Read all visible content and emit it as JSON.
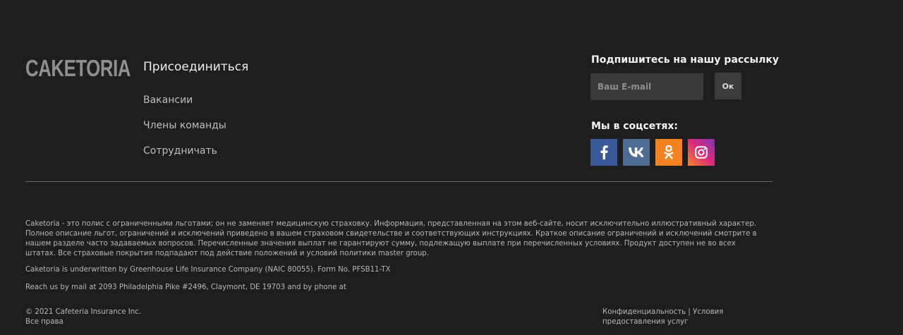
{
  "brand": {
    "logo_text": "CAKETORIA"
  },
  "links": {
    "heading": "Присоединиться",
    "items": [
      {
        "label": "Вакансии"
      },
      {
        "label": "Члены команды"
      },
      {
        "label": "Сотрудничать"
      }
    ]
  },
  "newsletter": {
    "heading": "Подпишитесь на нашу рассылку",
    "email_placeholder": "Ваш E-mail",
    "email_value": "",
    "submit_label": "Ок"
  },
  "social": {
    "heading": "Мы в соцсетях:",
    "networks": [
      {
        "name": "facebook",
        "icon": "facebook-icon",
        "color": "#3b5998"
      },
      {
        "name": "vk",
        "icon": "vk-icon",
        "color": "#4c6c91"
      },
      {
        "name": "odnoklassniki",
        "icon": "odnoklassniki-icon",
        "color": "#f58220"
      },
      {
        "name": "instagram",
        "icon": "instagram-icon",
        "color": "#dd2a7b"
      }
    ]
  },
  "legal": {
    "disclaimer": "Caketoria - это полис с ограниченными льготами; он не заменяет медицинскую страховку. Информация, представленная на этом веб-сайте, носит исключительно иллюстративный характер. Полное описание льгот, ограничений и исключений приведено в вашем страховом свидетельстве и соответствующих инструкциях. Краткое описание ограничений и исключений смотрите в нашем разделе часто задаваемых вопросов. Перечисленные значения выплат не гарантируют сумму, подлежащую выплате при перечисленных условиях. Продукт доступен не во всех штатах. Все страховые покрытия подпадают под действие положений и условий политики master group.",
    "underwriter": "Caketoria is underwritten by Greenhouse Life Insurance Company (NAIC 80055). Form No. PFSB11-TX",
    "contact": "Reach us by mail at 2093 Philadelphia Pike #2496, Claymont, DE 19703 and by phone at",
    "copyright_line1": "© 2021 Cafeteria Insurance Inc.",
    "copyright_line2": "Все права",
    "privacy_label": "Конфиденциальность",
    "separator": " | ",
    "terms_label": "Условия предоставления услуг"
  },
  "colors": {
    "background": "#1f1e1f",
    "divider": "#6a6a6a"
  }
}
